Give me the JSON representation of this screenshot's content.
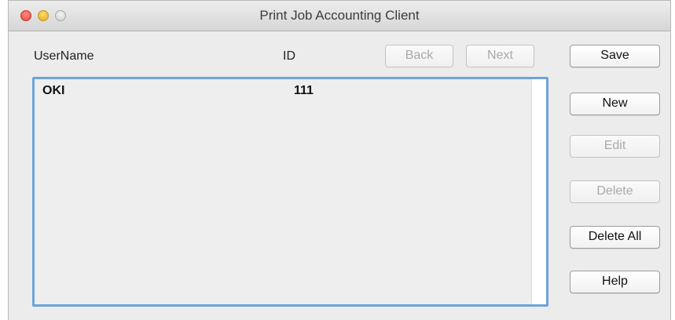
{
  "window": {
    "title": "Print Job Accounting Client"
  },
  "columns": {
    "username": "UserName",
    "id": "ID"
  },
  "nav": {
    "back_label": "Back",
    "next_label": "Next"
  },
  "list": {
    "rows": [
      {
        "username": "OKI",
        "id": "111"
      }
    ]
  },
  "actions": {
    "save_label": "Save",
    "new_label": "New",
    "edit_label": "Edit",
    "delete_label": "Delete",
    "delete_all_label": "Delete All",
    "help_label": "Help"
  },
  "colors": {
    "focus_ring": "#6fa2dc",
    "window_bg": "#ececec",
    "close_light": "#e0443a",
    "minimize_light": "#e3a820",
    "zoom_light": "#cfcfcf"
  }
}
